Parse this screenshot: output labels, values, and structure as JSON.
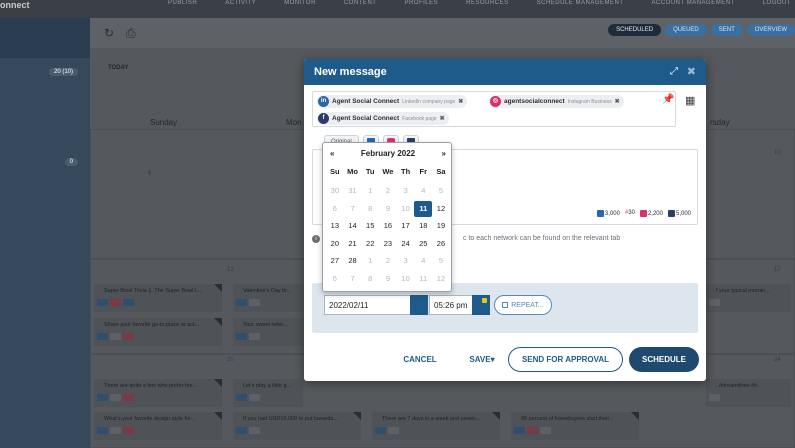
{
  "app": {
    "brand": "onnect"
  },
  "topnav": [
    "PUBLISH",
    "ACTIVITY",
    "MONITOR",
    "CONTENT",
    "PROFILES",
    "RESOURCES",
    "SCHEDULE MANAGEMENT",
    "ACCOUNT MANAGEMENT",
    "LOGOUT"
  ],
  "sidebar": {
    "badge1": "20 (10)",
    "badge2": "0"
  },
  "toolbar": {
    "refresh_icon": "refresh-icon",
    "print_icon": "print-icon"
  },
  "viewtabs": [
    {
      "label": "SCHEDULED"
    },
    {
      "label": "QUEUED"
    },
    {
      "label": "SENT"
    },
    {
      "label": "OVERVIEW"
    }
  ],
  "calendar": {
    "today_label": "TODAY",
    "days": [
      "Sunday",
      "Mon",
      "",
      "",
      "",
      "rsday",
      ""
    ],
    "day_numbers": {
      "r1c6": "10",
      "r2c1": "13",
      "r2c6": "17",
      "r3c1": "20",
      "r3c6": "24",
      "r1c1": "6"
    },
    "posts": [
      {
        "text": "Super Bowl Trivia 1. The Super Bowl L..."
      },
      {
        "text": "Valentine's Day br..."
      },
      {
        "text": "Share your favorite go-to place or act..."
      },
      {
        "text": "Your sweet refer..."
      },
      {
        "text": "There are quite a few who prefer the..."
      },
      {
        "text": "Let's play a little g..."
      },
      {
        "text": "What's your favorite design style for..."
      },
      {
        "text": "If you had USD10,000 to put towards..."
      },
      {
        "text": "There are 7 days in a week and seven..."
      },
      {
        "text": "95 percent of homebuyers start their..."
      },
      {
        "text": "f your typical mornin..."
      },
      {
        "text": "..#dreamlifree #h..."
      }
    ]
  },
  "modal": {
    "title": "New message",
    "recipients": [
      {
        "name": "Agent Social Connect",
        "type": "LinkedIn company page",
        "network": "in"
      },
      {
        "name": "agentsocialconnect",
        "type": "Instagram Business",
        "network": "ig"
      },
      {
        "name": "Agent Social Connect",
        "type": "Facebook page",
        "network": "fb"
      }
    ],
    "tabs": {
      "original": "Original"
    },
    "counts": {
      "linkedin": "3,000",
      "twitter": "30",
      "instagram": "2,200",
      "facebook": "5,000"
    },
    "info_text": "c to each network can be found on the relevant tab",
    "date_value": "2022/02/11",
    "time_value": "05:26 pm",
    "repeat_label": "REPEAT...",
    "buttons": {
      "cancel": "CANCEL",
      "save": "SAVE",
      "approval": "SEND FOR APPROVAL",
      "schedule": "SCHEDULE"
    }
  },
  "datepicker": {
    "prev": "«",
    "next": "»",
    "month": "February 2022",
    "dow": [
      "Su",
      "Mo",
      "Tu",
      "We",
      "Th",
      "Fr",
      "Sa"
    ],
    "weeks": [
      [
        [
          "30",
          "o"
        ],
        [
          "31",
          "o"
        ],
        [
          "1",
          "o"
        ],
        [
          "2",
          "o"
        ],
        [
          "3",
          "o"
        ],
        [
          "4",
          "o"
        ],
        [
          "5",
          "o"
        ]
      ],
      [
        [
          "6",
          "o"
        ],
        [
          "7",
          "o"
        ],
        [
          "8",
          "o"
        ],
        [
          "9",
          "o"
        ],
        [
          "10",
          "o"
        ],
        [
          "11",
          "s"
        ],
        [
          "12",
          ""
        ]
      ],
      [
        [
          "13",
          ""
        ],
        [
          "14",
          ""
        ],
        [
          "15",
          ""
        ],
        [
          "16",
          ""
        ],
        [
          "17",
          ""
        ],
        [
          "18",
          ""
        ],
        [
          "19",
          ""
        ]
      ],
      [
        [
          "20",
          ""
        ],
        [
          "21",
          ""
        ],
        [
          "22",
          ""
        ],
        [
          "23",
          ""
        ],
        [
          "24",
          ""
        ],
        [
          "25",
          ""
        ],
        [
          "26",
          ""
        ]
      ],
      [
        [
          "27",
          ""
        ],
        [
          "28",
          ""
        ],
        [
          "1",
          "o"
        ],
        [
          "2",
          "o"
        ],
        [
          "3",
          "o"
        ],
        [
          "4",
          "o"
        ],
        [
          "5",
          "o"
        ]
      ],
      [
        [
          "6",
          "o"
        ],
        [
          "7",
          "o"
        ],
        [
          "8",
          "o"
        ],
        [
          "9",
          "o"
        ],
        [
          "10",
          "o"
        ],
        [
          "11",
          "o"
        ],
        [
          "12",
          "o"
        ]
      ]
    ]
  },
  "colors": {
    "primary": "#1e5b8a",
    "selected_day": "#1e5b8a",
    "dark_button": "#1e4a70"
  }
}
